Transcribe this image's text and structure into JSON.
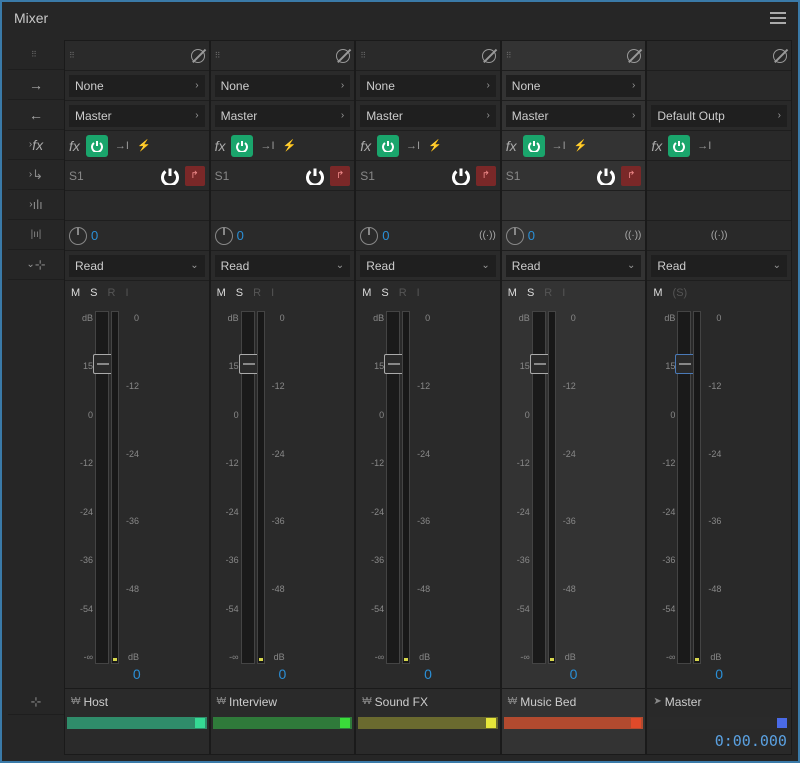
{
  "panel": {
    "title": "Mixer"
  },
  "routing": {
    "input_label": "None",
    "output_label": "Master",
    "master_output": "Default Outp"
  },
  "fx": {
    "label": "fx"
  },
  "send": {
    "label": "S1"
  },
  "pan": {
    "value": "0"
  },
  "automation": {
    "mode": "Read"
  },
  "ms": {
    "m": "M",
    "s": "S",
    "r": "R",
    "i": "I",
    "paren_s": "(S)"
  },
  "fader": {
    "left_ticks": [
      "dB",
      "15",
      "0",
      "-12",
      "-24",
      "-36",
      "-54",
      "-∞"
    ],
    "right_ticks": [
      "0",
      "-12",
      "-24",
      "-36",
      "-48",
      "dB"
    ],
    "value": "0"
  },
  "channels": [
    {
      "name": "Host",
      "color": "#2f8c6a",
      "sq": "#35d994",
      "stereo": false
    },
    {
      "name": "Interview",
      "color": "#2f7a3a",
      "sq": "#3adc3a",
      "stereo": false
    },
    {
      "name": "Sound FX",
      "color": "#6a6a2f",
      "sq": "#e6e63a",
      "stereo": true
    },
    {
      "name": "Music Bed",
      "color": "#b24a2f",
      "sq": "#e04a2a",
      "stereo": true,
      "selected": true
    }
  ],
  "master": {
    "name": "Master",
    "color": "#2a2a2a",
    "sq": "#4a6ae6",
    "time": "0:00.000"
  }
}
